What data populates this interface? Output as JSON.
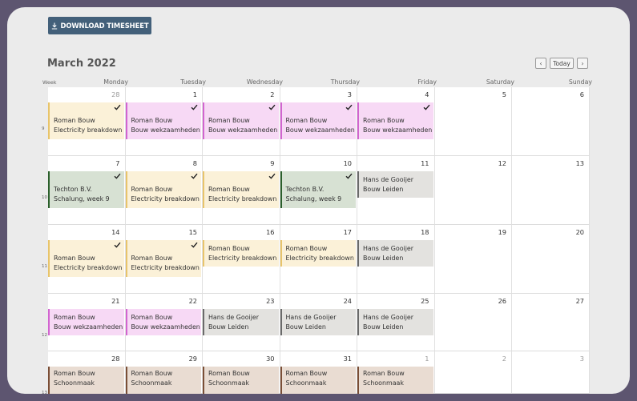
{
  "toolbar": {
    "download_label": "DOWNLOAD TIMESHEET"
  },
  "calendar": {
    "title": "March 2022",
    "nav": {
      "prev": "‹",
      "today": "Today",
      "next": "›"
    },
    "week_header": "Week",
    "days": [
      "Monday",
      "Tuesday",
      "Wednesday",
      "Thursday",
      "Friday",
      "Saturday",
      "Sunday"
    ],
    "weeks": [
      {
        "num": "9",
        "cells": [
          {
            "day": "28",
            "other": true,
            "event": {
              "color": "yellow",
              "line1": "Roman Bouw",
              "line2": "Electricity breakdown",
              "check": true
            }
          },
          {
            "day": "1",
            "event": {
              "color": "pink",
              "line1": "Roman Bouw",
              "line2": "Bouw wekzaamheden",
              "check": true
            }
          },
          {
            "day": "2",
            "event": {
              "color": "pink",
              "line1": "Roman Bouw",
              "line2": "Bouw wekzaamheden",
              "check": true
            }
          },
          {
            "day": "3",
            "event": {
              "color": "pink",
              "line1": "Roman Bouw",
              "line2": "Bouw wekzaamheden",
              "check": true
            }
          },
          {
            "day": "4",
            "event": {
              "color": "pink",
              "line1": "Roman Bouw",
              "line2": "Bouw wekzaamheden",
              "check": true
            }
          },
          {
            "day": "5"
          },
          {
            "day": "6"
          }
        ]
      },
      {
        "num": "10",
        "cells": [
          {
            "day": "7",
            "event": {
              "color": "green",
              "line1": "Techton B.V.",
              "line2": "Schalung, week 9",
              "check": true
            }
          },
          {
            "day": "8",
            "event": {
              "color": "yellow",
              "line1": "Roman Bouw",
              "line2": "Electricity breakdown",
              "check": true
            }
          },
          {
            "day": "9",
            "event": {
              "color": "yellow",
              "line1": "Roman Bouw",
              "line2": "Electricity breakdown",
              "check": true
            }
          },
          {
            "day": "10",
            "event": {
              "color": "green",
              "line1": "Techton B.V.",
              "line2": "Schalung, week 9",
              "check": true
            }
          },
          {
            "day": "11",
            "event": {
              "color": "gray",
              "line1": "Hans de Gooijer",
              "line2": "Bouw Leiden",
              "check": false,
              "short": true
            }
          },
          {
            "day": "12"
          },
          {
            "day": "13"
          }
        ]
      },
      {
        "num": "11",
        "cells": [
          {
            "day": "14",
            "event": {
              "color": "yellow",
              "line1": "Roman Bouw",
              "line2": "Electricity breakdown",
              "check": true
            }
          },
          {
            "day": "15",
            "event": {
              "color": "yellow",
              "line1": "Roman Bouw",
              "line2": "Electricity breakdown",
              "check": true
            }
          },
          {
            "day": "16",
            "event": {
              "color": "yellow",
              "line1": "Roman Bouw",
              "line2": "Electricity breakdown",
              "check": false,
              "short": true
            }
          },
          {
            "day": "17",
            "event": {
              "color": "yellow",
              "line1": "Roman Bouw",
              "line2": "Electricity breakdown",
              "check": false,
              "short": true
            }
          },
          {
            "day": "18",
            "event": {
              "color": "gray",
              "line1": "Hans de Gooijer",
              "line2": "Bouw Leiden",
              "check": false,
              "short": true
            }
          },
          {
            "day": "19"
          },
          {
            "day": "20"
          }
        ]
      },
      {
        "num": "12",
        "cells": [
          {
            "day": "21",
            "event": {
              "color": "pink",
              "line1": "Roman Bouw",
              "line2": "Bouw wekzaamheden",
              "check": false,
              "short": true
            }
          },
          {
            "day": "22",
            "event": {
              "color": "pink",
              "line1": "Roman Bouw",
              "line2": "Bouw wekzaamheden",
              "check": false,
              "short": true
            }
          },
          {
            "day": "23",
            "event": {
              "color": "gray",
              "line1": "Hans de Gooijer",
              "line2": "Bouw Leiden",
              "check": false,
              "short": true
            }
          },
          {
            "day": "24",
            "event": {
              "color": "gray",
              "line1": "Hans de Gooijer",
              "line2": "Bouw Leiden",
              "check": false,
              "short": true
            }
          },
          {
            "day": "25",
            "event": {
              "color": "gray",
              "line1": "Hans de Gooijer",
              "line2": "Bouw Leiden",
              "check": false,
              "short": true
            }
          },
          {
            "day": "26"
          },
          {
            "day": "27"
          }
        ]
      },
      {
        "num": "13",
        "cells": [
          {
            "day": "28",
            "event": {
              "color": "brown",
              "line1": "Roman Bouw",
              "line2": "Schoonmaak",
              "check": false
            }
          },
          {
            "day": "29",
            "event": {
              "color": "brown",
              "line1": "Roman Bouw",
              "line2": "Schoonmaak",
              "check": false
            }
          },
          {
            "day": "30",
            "event": {
              "color": "brown",
              "line1": "Roman Bouw",
              "line2": "Schoonmaak",
              "check": false
            }
          },
          {
            "day": "31",
            "event": {
              "color": "brown",
              "line1": "Roman Bouw",
              "line2": "Schoonmaak",
              "check": false
            }
          },
          {
            "day": "1",
            "other": true,
            "event": {
              "color": "brown",
              "line1": "Roman Bouw",
              "line2": "Schoonmaak",
              "check": false
            }
          },
          {
            "day": "2",
            "other": true
          },
          {
            "day": "3",
            "other": true
          }
        ]
      }
    ]
  }
}
